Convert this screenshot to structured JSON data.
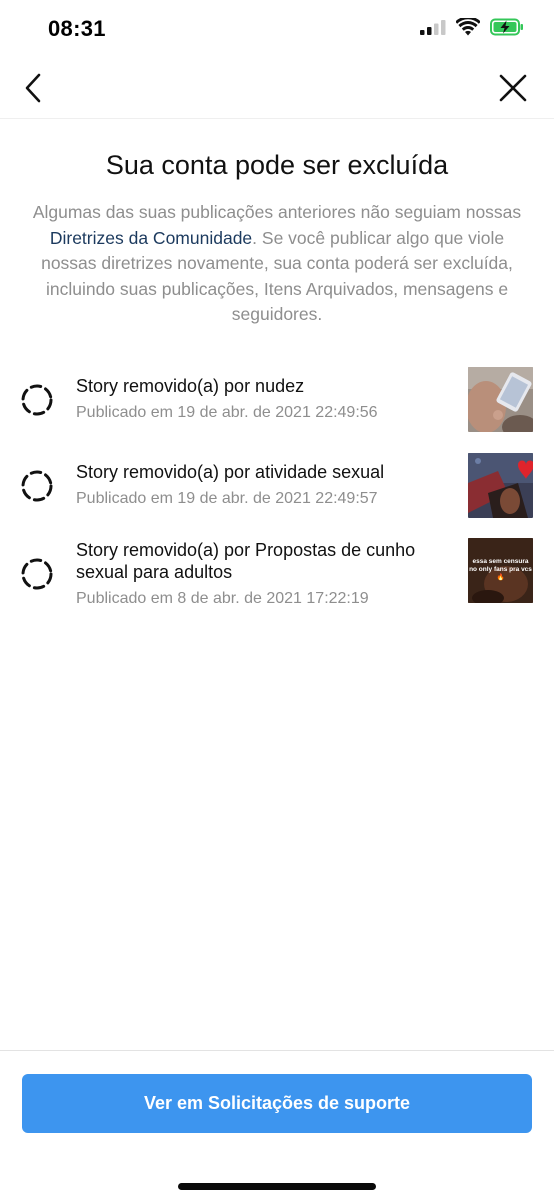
{
  "status_bar": {
    "time": "08:31",
    "icons": [
      "cellular-signal-icon",
      "wifi-icon",
      "battery-charging-icon"
    ]
  },
  "nav": {
    "back_icon": "chevron-left-icon",
    "close_icon": "close-icon"
  },
  "heading": {
    "title": "Sua conta pode ser excluída",
    "description_before": "Algumas das suas publicações anteriores não seguiam nossas ",
    "description_link": "Diretrizes da Comunidade",
    "description_after": ". Se você publicar algo que viole nossas diretrizes novamente, sua conta poderá ser excluída, incluindo suas publicações, Itens Arquivados, mensagens e seguidores."
  },
  "violations": [
    {
      "title": "Story removido(a) por nudez",
      "date": "Publicado em 19 de abr. de 2021 22:49:56"
    },
    {
      "title": "Story removido(a) por atividade sexual",
      "date": "Publicado em 19 de abr. de 2021 22:49:57"
    },
    {
      "title": "Story removido(a) por Propostas de cunho sexual para adultos",
      "date": "Publicado em 8 de abr. de 2021 17:22:19",
      "thumbnail_caption": "essa sem censura no only fans pra vcs 🔥"
    }
  ],
  "footer": {
    "button_label": "Ver em Solicitações de suporte"
  },
  "colors": {
    "accent": "#3d95ef",
    "link": "#1c3a5e",
    "secondary_text": "#8e8e8e",
    "battery_green": "#34c759"
  }
}
